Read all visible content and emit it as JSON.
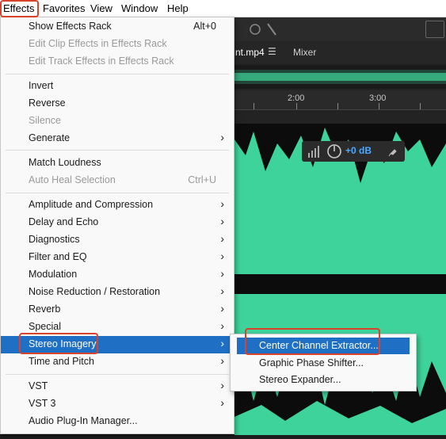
{
  "menubar": {
    "items": [
      {
        "label": "Effects"
      },
      {
        "label": "Favorites"
      },
      {
        "label": "View"
      },
      {
        "label": "Window"
      },
      {
        "label": "Help"
      }
    ]
  },
  "editor": {
    "file_tab": "nt.mp4",
    "mixer_tab": "Mixer",
    "ruler_labels": [
      "2:00",
      "3:00"
    ],
    "hud_gain": "+0 dB"
  },
  "effects_menu": {
    "items": [
      {
        "label": "Show Effects Rack",
        "shortcut": "Alt+0"
      },
      {
        "label": "Edit Clip Effects in Effects Rack"
      },
      {
        "label": "Edit Track Effects in Effects Rack"
      },
      {
        "label": "Invert"
      },
      {
        "label": "Reverse"
      },
      {
        "label": "Silence"
      },
      {
        "label": "Generate"
      },
      {
        "label": "Match Loudness"
      },
      {
        "label": "Auto Heal Selection",
        "shortcut": "Ctrl+U"
      },
      {
        "label": "Amplitude and Compression"
      },
      {
        "label": "Delay and Echo"
      },
      {
        "label": "Diagnostics"
      },
      {
        "label": "Filter and EQ"
      },
      {
        "label": "Modulation"
      },
      {
        "label": "Noise Reduction / Restoration"
      },
      {
        "label": "Reverb"
      },
      {
        "label": "Special"
      },
      {
        "label": "Stereo Imagery"
      },
      {
        "label": "Time and Pitch"
      },
      {
        "label": "VST"
      },
      {
        "label": "VST 3"
      },
      {
        "label": "Audio Plug-In Manager..."
      }
    ]
  },
  "stereo_submenu": {
    "items": [
      {
        "label": "Center Channel Extractor..."
      },
      {
        "label": "Graphic Phase Shifter..."
      },
      {
        "label": "Stereo Expander..."
      }
    ]
  },
  "colors": {
    "highlight": "#1f6fc4",
    "callout": "#d9432c",
    "waveform": "#3ed39a"
  },
  "icons": [
    "chevron-right-icon",
    "menu-icon",
    "knob-icon",
    "level-meter-icon",
    "pin-icon"
  ]
}
